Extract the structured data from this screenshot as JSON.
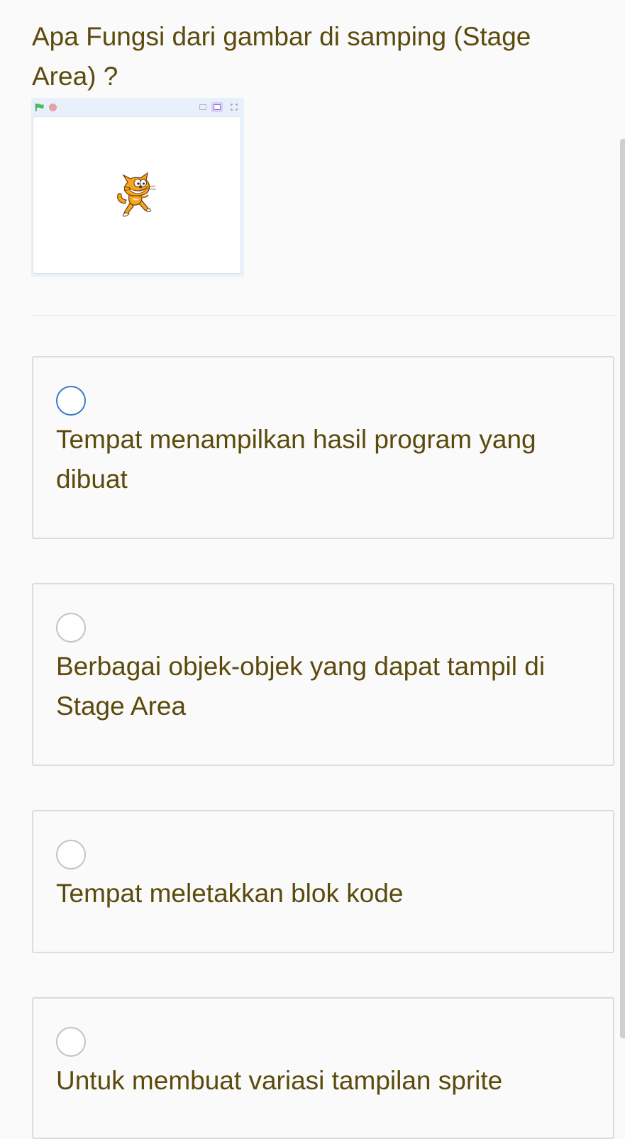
{
  "question": {
    "text": "Apa Fungsi dari gambar di samping (Stage Area) ?"
  },
  "stage_image": {
    "sprite_icon": "scratch-cat-sprite",
    "flag_icon": "green-flag-icon",
    "stop_icon": "stop-icon",
    "flag_color": "#4cbf56",
    "stop_color": "#e5a0a6"
  },
  "options": [
    {
      "label": "Tempat menampilkan hasil program yang dibuat",
      "selected": false,
      "focused": true
    },
    {
      "label": "Berbagai objek-objek yang dapat tampil di Stage Area",
      "selected": false,
      "focused": false
    },
    {
      "label": "Tempat meletakkan blok kode",
      "selected": false,
      "focused": false
    },
    {
      "label": "Untuk membuat variasi tampilan sprite",
      "selected": false,
      "focused": false
    }
  ],
  "colors": {
    "text": "#5c4a0c",
    "focus_ring": "#3a7bc8",
    "card_border": "#dcdcdc",
    "background": "#fafafa"
  }
}
